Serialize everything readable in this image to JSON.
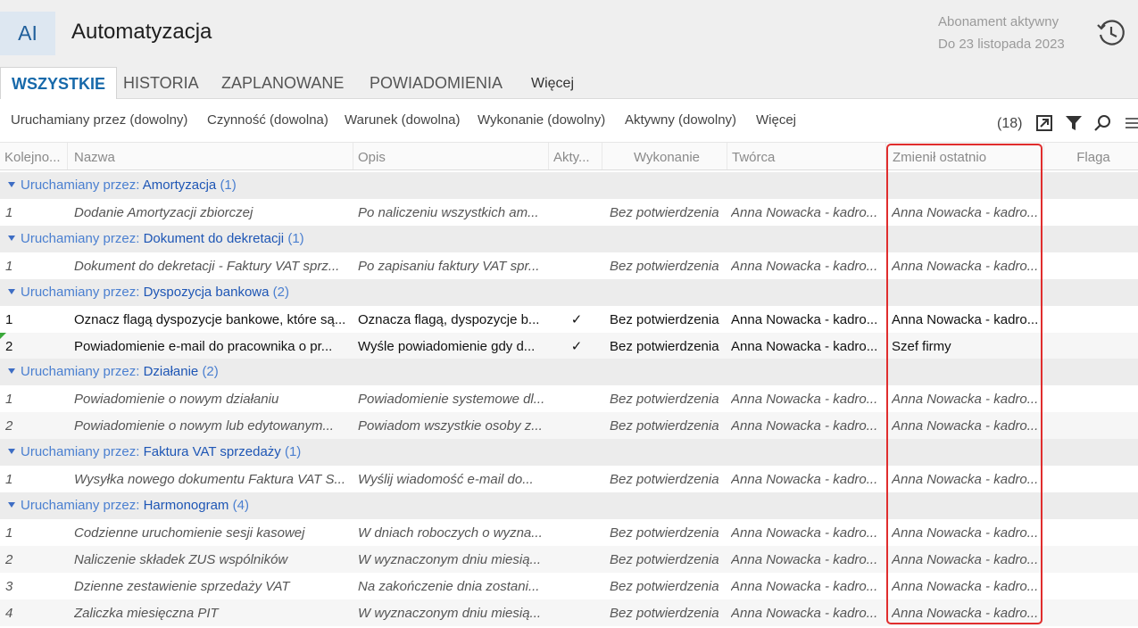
{
  "header": {
    "app_badge": "AI",
    "title": "Automatyzacja",
    "subscription_line1": "Abonament aktywny",
    "subscription_line2": "Do 23 listopada 2023"
  },
  "tabs": [
    {
      "label": "WSZYSTKIE",
      "active": true
    },
    {
      "label": "HISTORIA"
    },
    {
      "label": "ZAPLANOWANE"
    },
    {
      "label": "POWIADOMIENIA"
    },
    {
      "label": "Więcej"
    }
  ],
  "filters": [
    "Uruchamiany przez (dowolny)",
    "Czynność (dowolna)",
    "Warunek (dowolna)",
    "Wykonanie (dowolny)",
    "Aktywny (dowolny)",
    "Więcej"
  ],
  "toolbar": {
    "count": "(18)"
  },
  "columns": [
    "Kolejno...",
    "Nazwa",
    "Opis",
    "Akty...",
    "Wykonanie",
    "Twórca",
    "Zmienił ostatnio",
    "Flaga"
  ],
  "group_prefix": "Uruchamiany przez:",
  "groups": [
    {
      "name": "Amortyzacja",
      "count": "(1)"
    },
    {
      "name": "Dokument do dekretacji",
      "count": "(1)"
    },
    {
      "name": "Dyspozycja bankowa",
      "count": "(2)"
    },
    {
      "name": "Działanie",
      "count": "(2)"
    },
    {
      "name": "Faktura VAT sprzedaży",
      "count": "(1)"
    },
    {
      "name": "Harmonogram",
      "count": "(4)"
    }
  ],
  "rows": [
    {
      "num": "1",
      "name": "Dodanie Amortyzacji zbiorczej",
      "desc": "Po naliczeniu wszystkich am...",
      "active": "",
      "exec": "Bez potwierdzenia",
      "creator": "Anna Nowacka - kadro...",
      "modified": "Anna Nowacka - kadro..."
    },
    {
      "num": "1",
      "name": "Dokument do dekretacji - Faktury VAT sprz...",
      "desc": "Po zapisaniu faktury VAT spr...",
      "active": "",
      "exec": "Bez potwierdzenia",
      "creator": "Anna Nowacka - kadro...",
      "modified": "Anna Nowacka - kadro..."
    },
    {
      "num": "1",
      "name": "Oznacz flagą dyspozycje bankowe, które są...",
      "desc": "Oznacza flagą, dyspozycje b...",
      "active": "✓",
      "exec": "Bez potwierdzenia",
      "creator": "Anna Nowacka - kadro...",
      "modified": "Anna Nowacka - kadro..."
    },
    {
      "num": "2",
      "name": "Powiadomienie e-mail do pracownika o pr...",
      "desc": "Wyśle powiadomienie gdy d...",
      "active": "✓",
      "exec": "Bez potwierdzenia",
      "creator": "Anna Nowacka - kadro...",
      "modified": "Szef firmy"
    },
    {
      "num": "1",
      "name": "Powiadomienie o nowym działaniu",
      "desc": "Powiadomienie systemowe dl...",
      "active": "",
      "exec": "Bez potwierdzenia",
      "creator": "Anna Nowacka - kadro...",
      "modified": "Anna Nowacka - kadro..."
    },
    {
      "num": "2",
      "name": "Powiadomienie o nowym lub edytowanym...",
      "desc": "Powiadom wszystkie osoby z...",
      "active": "",
      "exec": "Bez potwierdzenia",
      "creator": "Anna Nowacka - kadro...",
      "modified": "Anna Nowacka - kadro..."
    },
    {
      "num": "1",
      "name": "Wysyłka nowego dokumentu Faktura VAT S...",
      "desc": "Wyślij wiadomość e-mail do...",
      "active": "",
      "exec": "Bez potwierdzenia",
      "creator": "Anna Nowacka - kadro...",
      "modified": "Anna Nowacka - kadro..."
    },
    {
      "num": "1",
      "name": "Codzienne uruchomienie sesji kasowej",
      "desc": "W dniach roboczych o wyzna...",
      "active": "",
      "exec": "Bez potwierdzenia",
      "creator": "Anna Nowacka - kadro...",
      "modified": "Anna Nowacka - kadro..."
    },
    {
      "num": "2",
      "name": "Naliczenie składek ZUS wspólników",
      "desc": "W wyznaczonym dniu miesią...",
      "active": "",
      "exec": "Bez potwierdzenia",
      "creator": "Anna Nowacka - kadro...",
      "modified": "Anna Nowacka - kadro..."
    },
    {
      "num": "3",
      "name": "Dzienne zestawienie sprzedaży VAT",
      "desc": "Na zakończenie dnia zostani...",
      "active": "",
      "exec": "Bez potwierdzenia",
      "creator": "Anna Nowacka - kadro...",
      "modified": "Anna Nowacka - kadro..."
    },
    {
      "num": "4",
      "name": "Zaliczka miesięczna PIT",
      "desc": "W wyznaczonym dniu miesią...",
      "active": "",
      "exec": "Bez potwierdzenia",
      "creator": "Anna Nowacka - kadro...",
      "modified": "Anna Nowacka - kadro..."
    }
  ],
  "colors": {
    "accent": "#1769aa",
    "group_text": "#1e56b5",
    "highlight": "#e02d2d"
  }
}
